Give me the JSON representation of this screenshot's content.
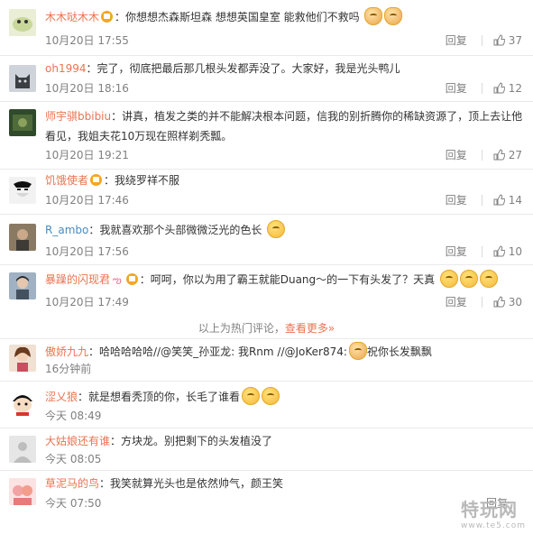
{
  "reply_label": "回复",
  "hot_divider": {
    "text": "以上为热门评论，",
    "more": "查看更多»"
  },
  "comments": [
    {
      "user": "木木哒木木",
      "badge": true,
      "text": "：你想想杰森斯坦森 想想英国皇室 能救他们不救吗",
      "time": "10月20日 17:55",
      "likes": "37",
      "emoji_count": 2
    },
    {
      "user": "oh1994",
      "badge": false,
      "text": "：完了，彻底把最后那几根头发都弄没了。大家好，我是光头鸭儿",
      "time": "10月20日 18:16",
      "likes": "12",
      "emoji_count": 0
    },
    {
      "user": "师宇骐bbibiu",
      "badge": false,
      "text": "：讲真，植发之类的并不能解决根本问题，信我的别折腾你的稀缺资源了，顶上去让他看见，我姐夫花10万现在照样剃秃瓢。",
      "time": "10月20日 19:21",
      "likes": "27",
      "emoji_count": 0
    },
    {
      "user": "饥饿使者",
      "badge": true,
      "text": "：我绕罗祥不服",
      "time": "10月20日 17:46",
      "likes": "14",
      "emoji_count": 0
    },
    {
      "user": "R_ambo",
      "badge": false,
      "text": "：我就喜欢那个头部微微泛光的色长",
      "time": "10月20日 17:56",
      "likes": "10",
      "emoji_count": 1
    },
    {
      "user": "暴躁的闪现君",
      "badge": true,
      "text": "：呵呵，你以为用了霸王就能Duang～的一下有头发了？天真",
      "time": "10月20日 17:49",
      "likes": "30",
      "emoji_count": 3
    },
    {
      "user": "傲娇九九",
      "badge": false,
      "text": "：哈哈哈哈哈//@笑笑_孙亚龙: 我Rnm //@JoKer874:",
      "text2": "祝你长发飘飘",
      "time": "16分钟前",
      "likes": "",
      "emoji_count": 1
    },
    {
      "user": "涩乂狼",
      "badge": false,
      "text": "：就是想看秃顶的你，长毛了谁看",
      "time": "今天 08:49",
      "likes": "",
      "emoji_count": 2
    },
    {
      "user": "大姑娘还有谁",
      "badge": false,
      "text": "：方块龙。别把剩下的头发植没了",
      "time": "今天 08:05",
      "likes": "",
      "emoji_count": 0
    },
    {
      "user": "草泥马的鸟",
      "badge": false,
      "text": "：我笑就算光头也是依然帅气，颜王笑",
      "time": "今天 07:50",
      "likes": "",
      "emoji_count": 0
    }
  ],
  "watermark": {
    "main": "特玩网",
    "sub": "www.te5.com"
  },
  "colors": {
    "username": "#eb7350",
    "meta": "#808080",
    "text": "#333333",
    "divider": "#eaeaea"
  }
}
